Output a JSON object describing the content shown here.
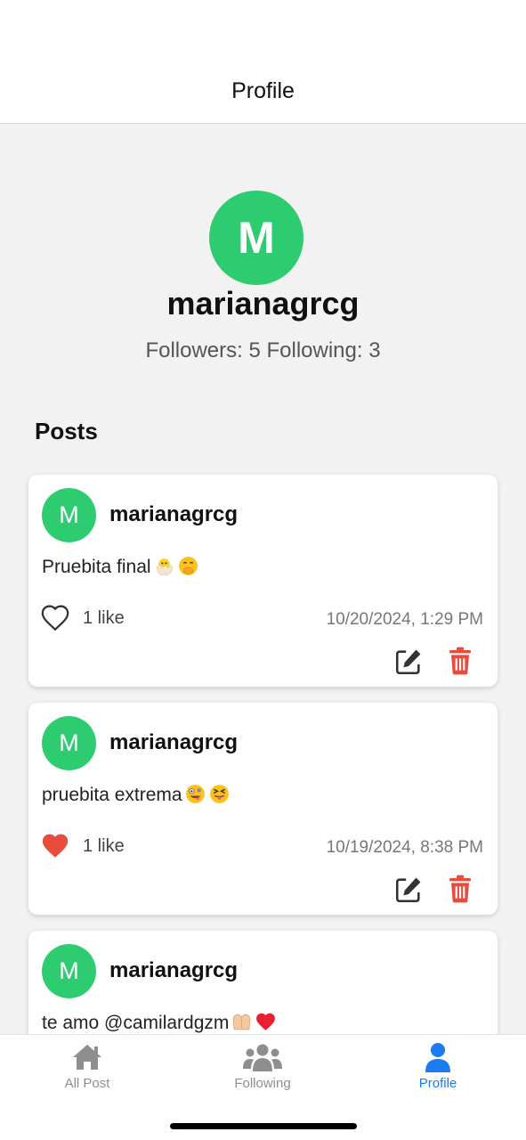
{
  "header": {
    "title": "Profile"
  },
  "profile": {
    "avatar_letter": "M",
    "username": "marianagrcg",
    "stats": "Followers: 5 Following: 3"
  },
  "posts_section": {
    "title": "Posts",
    "items": [
      {
        "avatar_letter": "M",
        "username": "marianagrcg",
        "text": "Pruebita final",
        "emojis": [
          "hatching-chick-emoji",
          "face-with-hand-over-mouth-emoji"
        ],
        "liked": false,
        "likes_label": "1 like",
        "date": "10/20/2024, 1:29 PM"
      },
      {
        "avatar_letter": "M",
        "username": "marianagrcg",
        "text": "pruebita extrema",
        "emojis": [
          "zany-face-emoji",
          "squinting-tongue-face-emoji"
        ],
        "liked": true,
        "likes_label": "1 like",
        "date": "10/19/2024, 8:38 PM"
      },
      {
        "avatar_letter": "M",
        "username": "marianagrcg",
        "text": "te amo @camilardgzm",
        "emojis": [
          "heart-hands-emoji",
          "red-heart-emoji"
        ]
      }
    ]
  },
  "tabbar": {
    "tabs": [
      {
        "label": "All Post",
        "icon": "home-icon",
        "active": false
      },
      {
        "label": "Following",
        "icon": "group-icon",
        "active": false
      },
      {
        "label": "Profile",
        "icon": "user-icon",
        "active": true
      }
    ]
  },
  "colors": {
    "avatar": "#2ecc71",
    "like_active": "#e74c3c",
    "delete": "#e74c3c",
    "tab_active": "#1a7bf2",
    "tab_inactive": "#8e8e8e"
  }
}
